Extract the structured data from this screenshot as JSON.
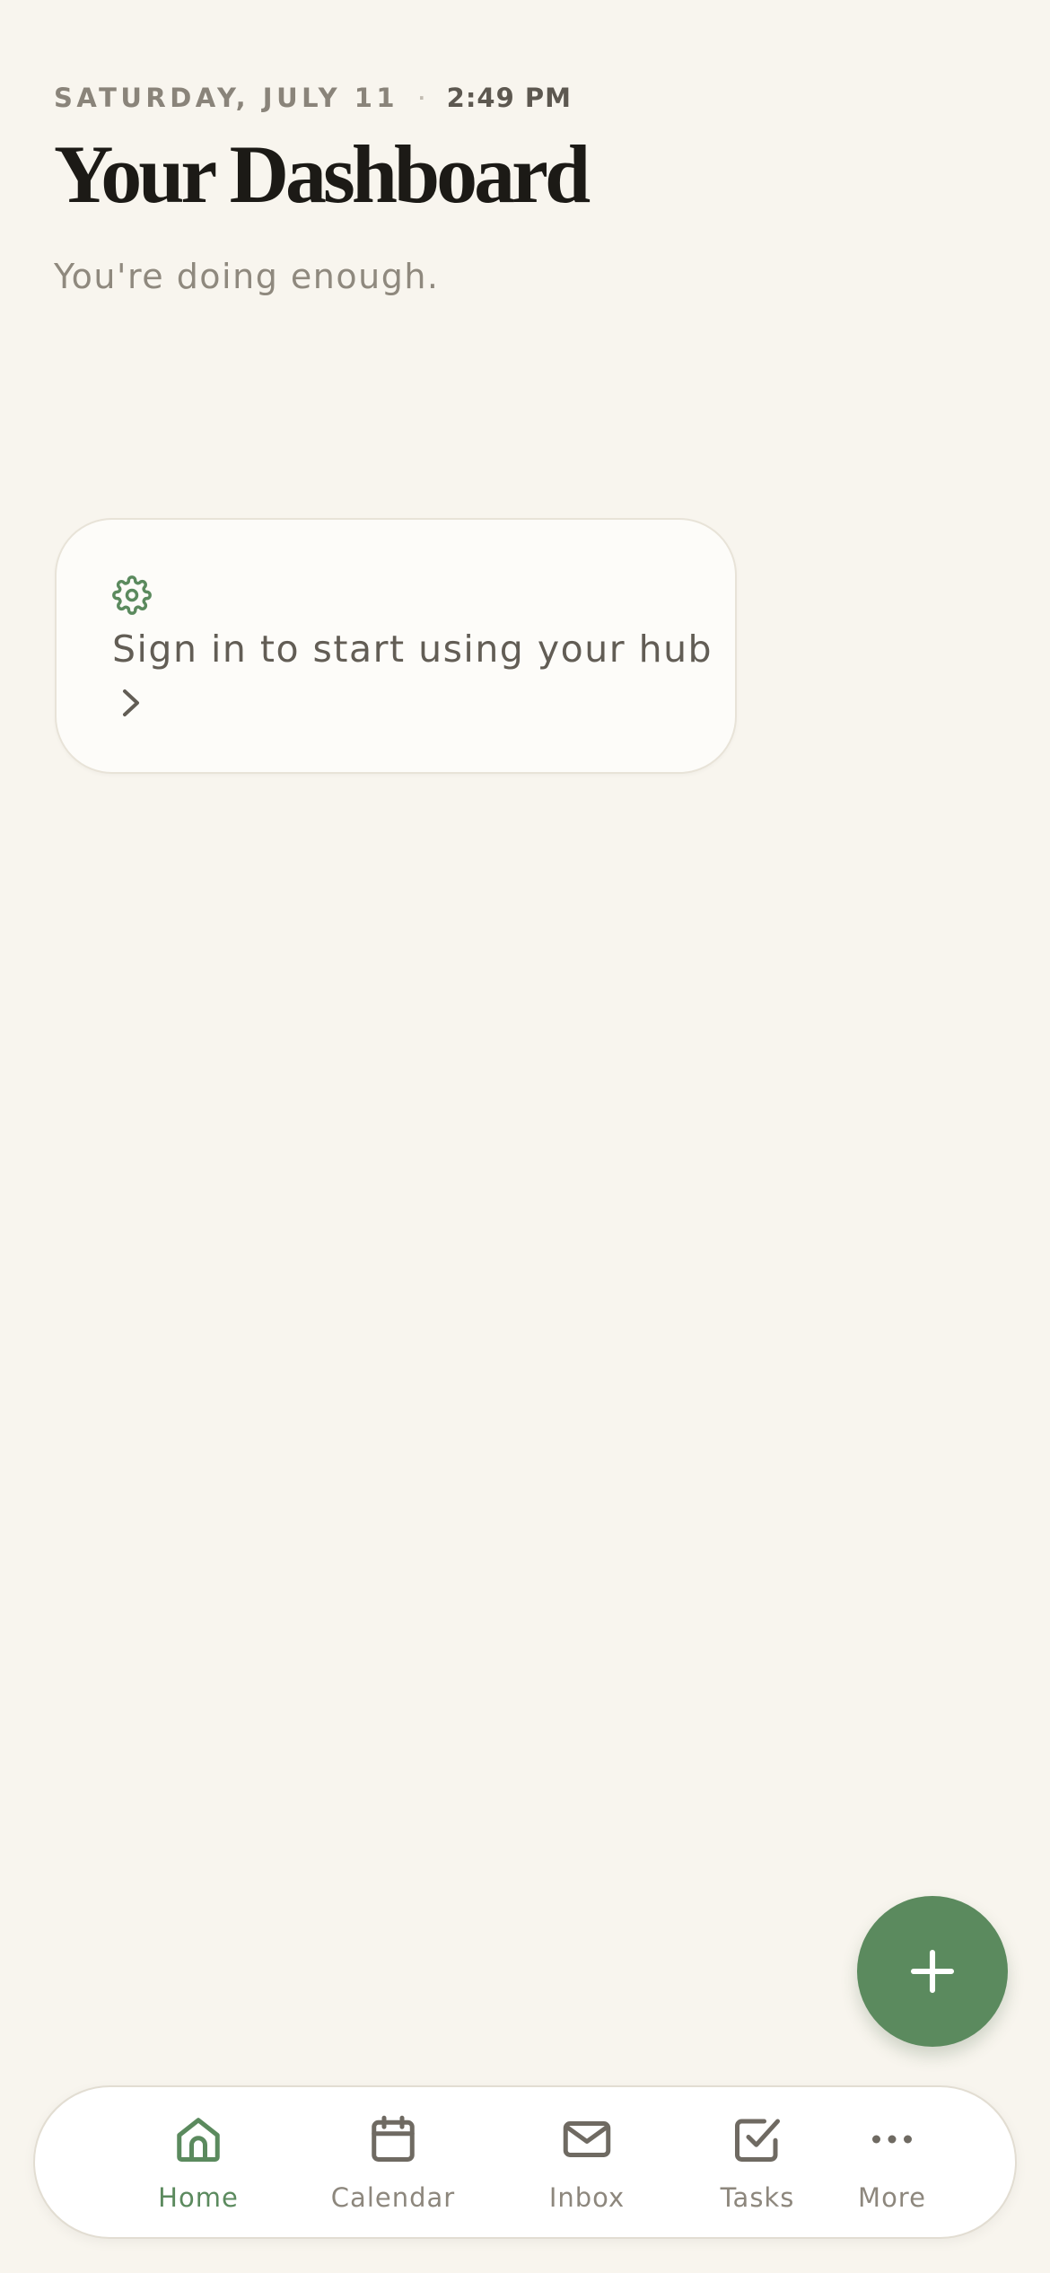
{
  "header": {
    "date": "SATURDAY, JULY 11",
    "separator": "·",
    "time": "2:49 PM",
    "title": "Your Dashboard",
    "subtitle": "You're doing enough."
  },
  "signin_card": {
    "icon": "gear-icon",
    "message": "Sign in to start using your hub",
    "chevron": "chevron-right-icon"
  },
  "fab": {
    "icon": "plus-icon"
  },
  "tabbar": {
    "items": [
      {
        "label": "Home",
        "icon": "home-icon",
        "active": true
      },
      {
        "label": "Calendar",
        "icon": "calendar-icon",
        "active": false
      },
      {
        "label": "Inbox",
        "icon": "mail-icon",
        "active": false
      },
      {
        "label": "Tasks",
        "icon": "checkbox-icon",
        "active": false
      },
      {
        "label": "More",
        "icon": "more-dots-icon",
        "active": false
      }
    ]
  },
  "colors": {
    "background": "#f8f5ee",
    "accent": "#5b8a5e",
    "title": "#1c1a16",
    "muted_text": "#8f897e",
    "card": "#fdfcf9"
  }
}
